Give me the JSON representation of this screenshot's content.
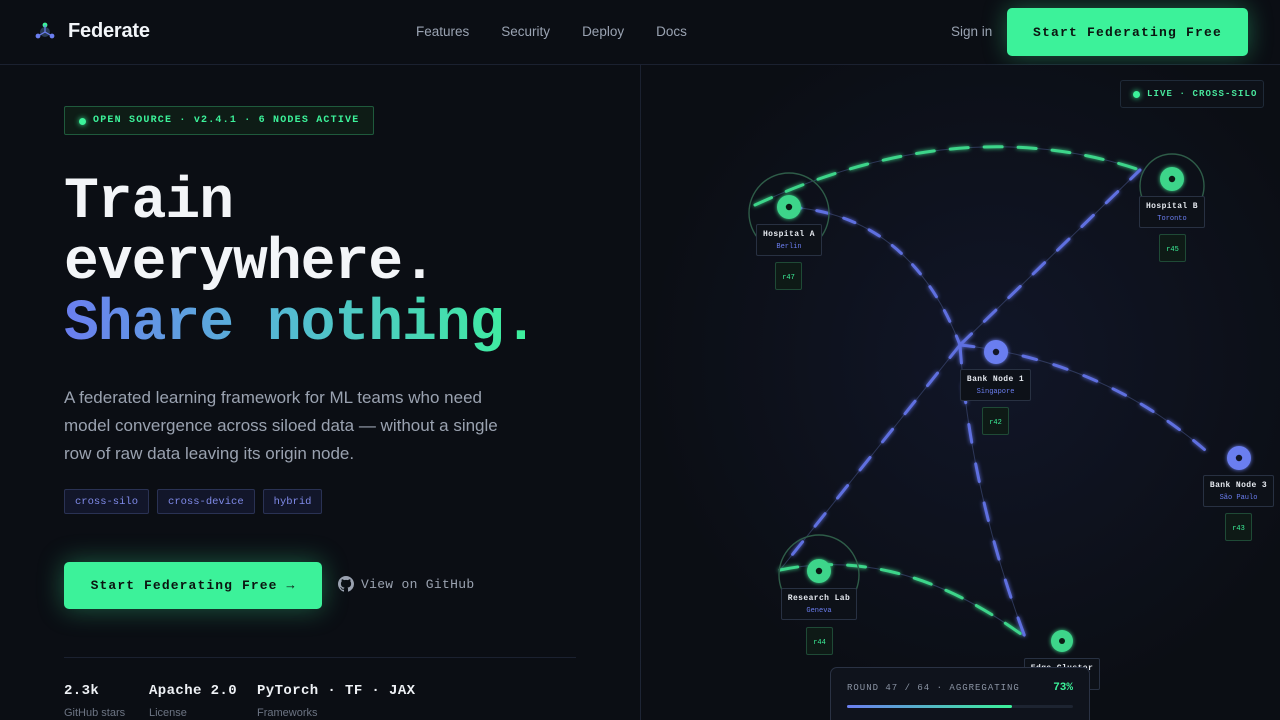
{
  "nav": {
    "brand": "Federate",
    "links": [
      "Features",
      "Security",
      "Deploy",
      "Docs"
    ],
    "signin": "Sign in",
    "cta": "Start Federating Free"
  },
  "hero": {
    "badge": "OPEN SOURCE · v2.4.1 · 6 NODES ACTIVE",
    "title_line1": "Train",
    "title_line2": "everywhere.",
    "title_line3": "Share nothing.",
    "lead": "A federated learning framework for ML teams who need model convergence across siloed data — without a single row of raw data leaving its origin node.",
    "tags": [
      "cross-silo",
      "cross-device",
      "hybrid"
    ],
    "cta": "Start Federating Free →",
    "github": "View on GitHub"
  },
  "stats": [
    {
      "value": "2.3k",
      "label": "GitHub stars"
    },
    {
      "value": "Apache 2.0",
      "label": "License"
    },
    {
      "value": "PyTorch · TF · JAX",
      "label": "Frameworks"
    }
  ],
  "network": {
    "live_badge": "LIVE · CROSS-SILO",
    "nodes": [
      {
        "name": "Hospital A",
        "city": "Berlin",
        "round": "r47",
        "kind": "green"
      },
      {
        "name": "Hospital B",
        "city": "Toronto",
        "round": "r45",
        "kind": "green"
      },
      {
        "name": "Bank Node 1",
        "city": "Singapore",
        "round": "r42",
        "kind": "blue"
      },
      {
        "name": "Bank Node 3",
        "city": "São Paulo",
        "round": "r43",
        "kind": "blue"
      },
      {
        "name": "Research Lab",
        "city": "Geneva",
        "round": "r44",
        "kind": "green"
      },
      {
        "name": "Edge Cluster",
        "city": "",
        "round": "",
        "kind": "green"
      }
    ],
    "round_status": "ROUND 47 / 64 · AGGREGATING",
    "round_pct": "73%",
    "round_progress": 0.73
  },
  "colors": {
    "accent_green": "#3cf29a",
    "accent_blue": "#6b7ef0",
    "background": "#0b0e14"
  }
}
